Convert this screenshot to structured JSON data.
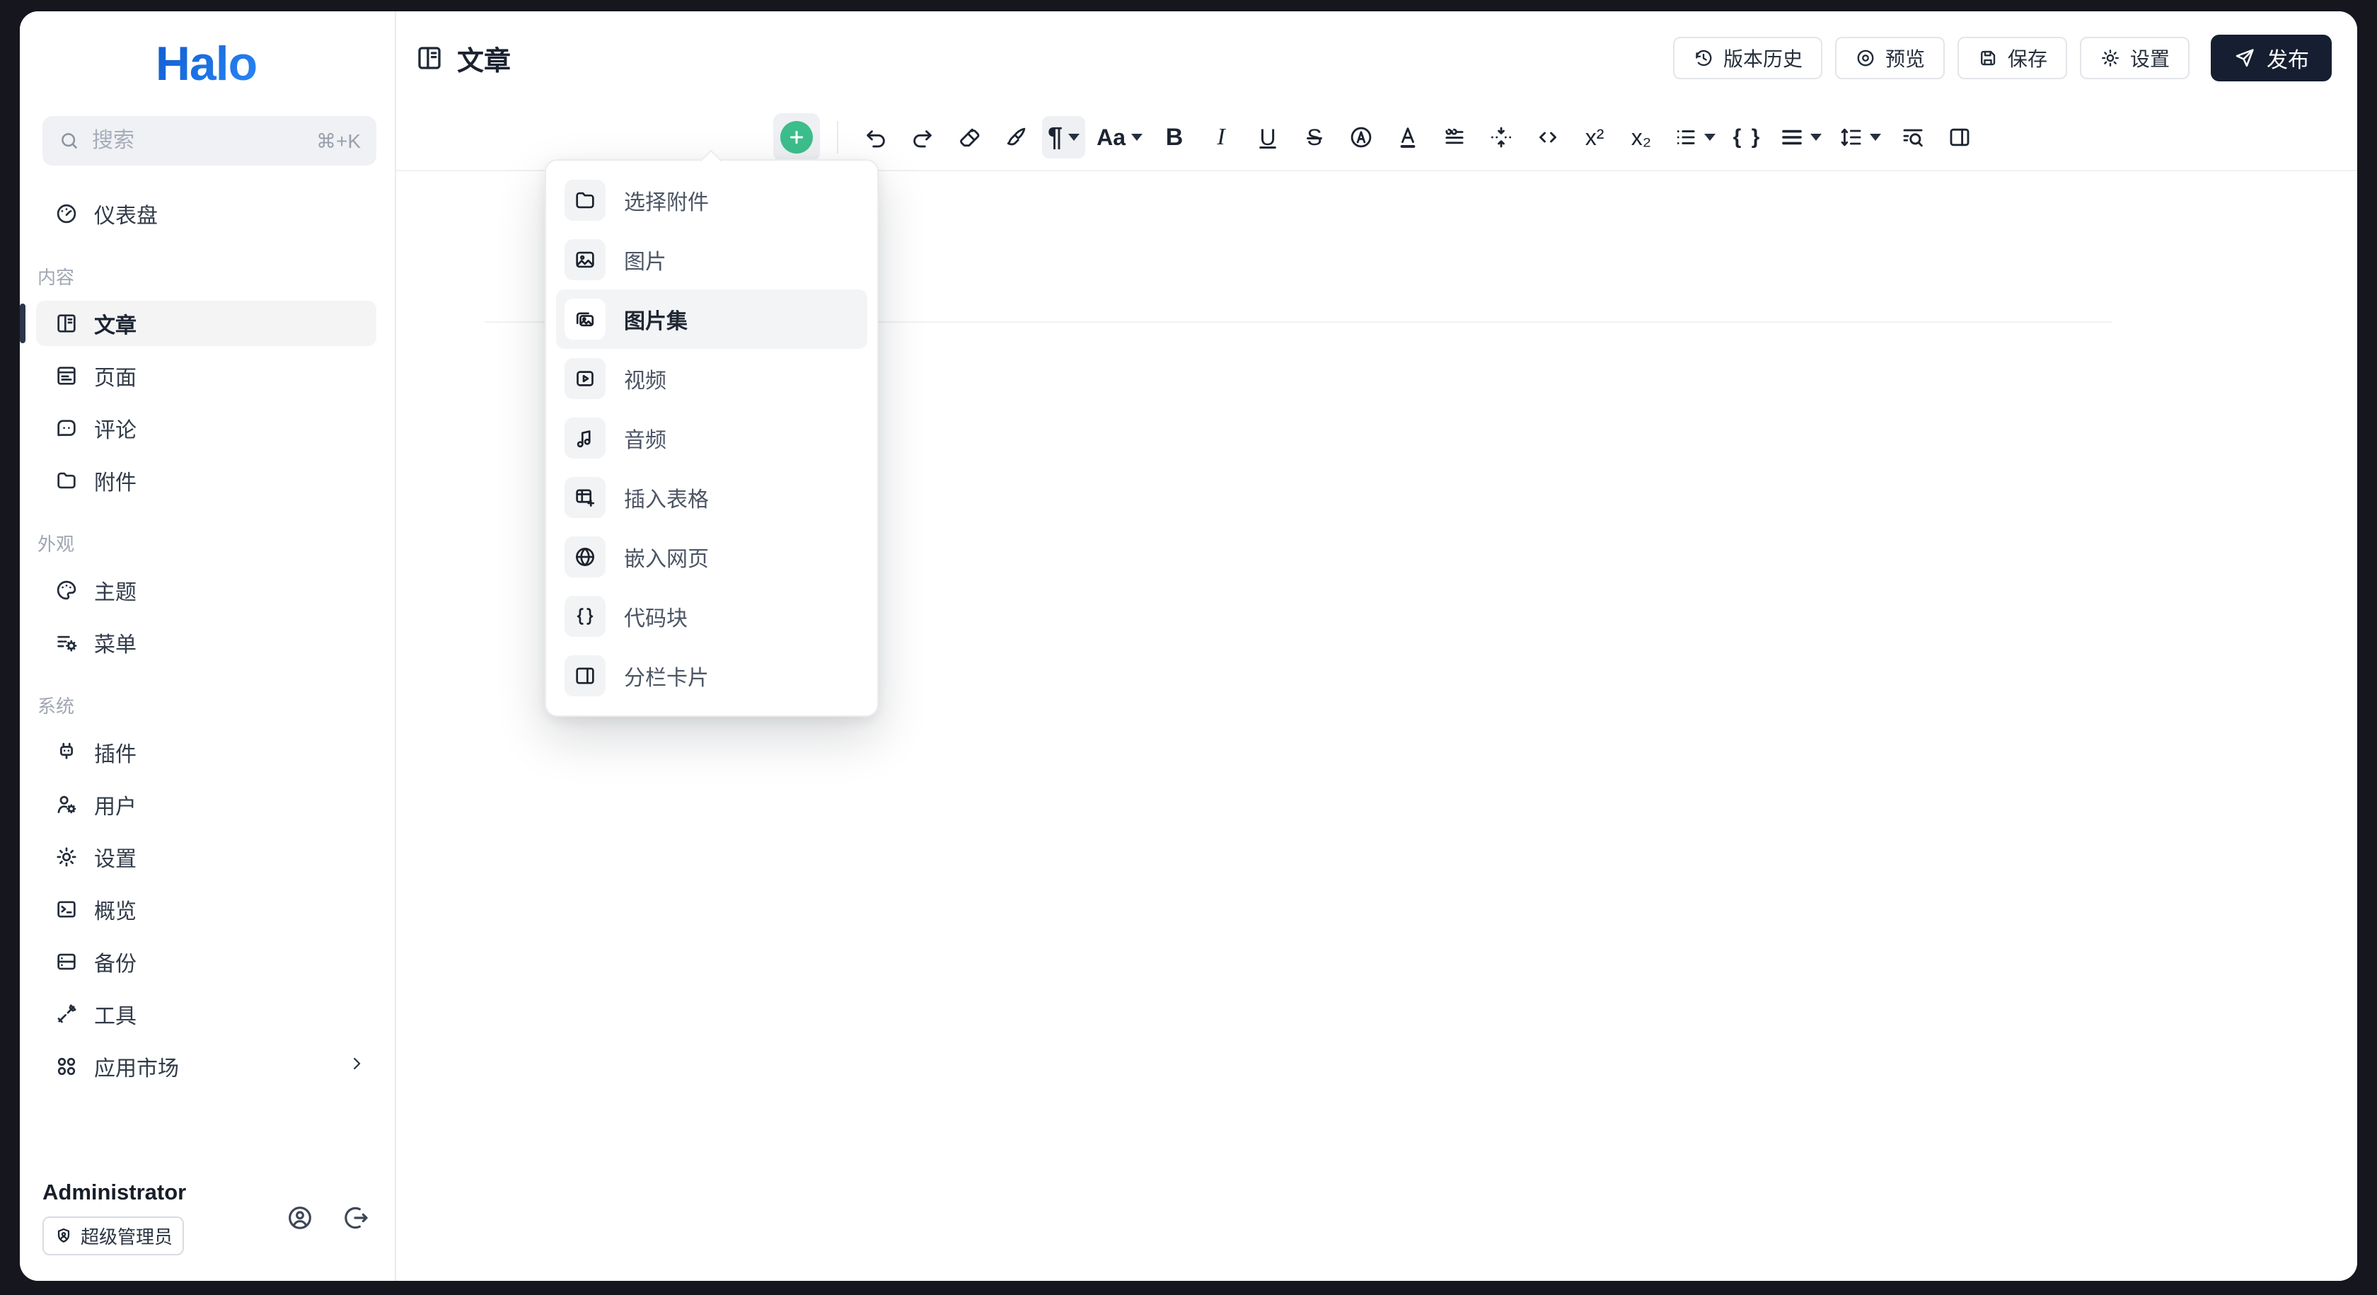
{
  "app": {
    "logo_text": "Halo"
  },
  "sidebar": {
    "search": {
      "placeholder": "搜索",
      "shortcut": "⌘+K"
    },
    "dashboard_label": "仪表盘",
    "sections": [
      {
        "label": "内容",
        "items": [
          {
            "label": "文章",
            "active": true
          },
          {
            "label": "页面"
          },
          {
            "label": "评论"
          },
          {
            "label": "附件"
          }
        ]
      },
      {
        "label": "外观",
        "items": [
          {
            "label": "主题"
          },
          {
            "label": "菜单"
          }
        ]
      },
      {
        "label": "系统",
        "items": [
          {
            "label": "插件"
          },
          {
            "label": "用户"
          },
          {
            "label": "设置"
          },
          {
            "label": "概览"
          },
          {
            "label": "备份"
          },
          {
            "label": "工具"
          },
          {
            "label": "应用市场",
            "has_submenu": true
          }
        ]
      }
    ],
    "user": {
      "name": "Administrator",
      "role": "超级管理员"
    }
  },
  "header": {
    "title": "文章",
    "actions": [
      {
        "label": "版本历史",
        "icon": "history-icon"
      },
      {
        "label": "预览",
        "icon": "preview-icon"
      },
      {
        "label": "保存",
        "icon": "save-icon"
      },
      {
        "label": "设置",
        "icon": "gear-icon"
      }
    ],
    "publish": {
      "label": "发布",
      "icon": "send-icon"
    }
  },
  "toolbar": {
    "icons": [
      "insert-plus",
      "undo",
      "redo",
      "eraser",
      "format-paint",
      "paragraph",
      "typography",
      "bold",
      "italic",
      "underline",
      "strikethrough",
      "highlight",
      "text-color",
      "blockquote",
      "vertical-collapse",
      "code",
      "superscript",
      "subscript",
      "bullet-list",
      "code-block",
      "align",
      "line-height",
      "find-replace",
      "columns"
    ],
    "glyphs": {
      "paragraph": "¶",
      "typography": "Aa",
      "bold": "B",
      "italic": "I",
      "underline": "U",
      "strikethrough": "S",
      "superscript": "x²",
      "subscript": "x₂",
      "code_block": "{ }"
    }
  },
  "insert_menu": {
    "items": [
      {
        "label": "选择附件",
        "icon": "folder-icon"
      },
      {
        "label": "图片",
        "icon": "image-icon"
      },
      {
        "label": "图片集",
        "icon": "images-icon",
        "active": true
      },
      {
        "label": "视频",
        "icon": "video-icon"
      },
      {
        "label": "音频",
        "icon": "audio-icon"
      },
      {
        "label": "插入表格",
        "icon": "table-plus-icon"
      },
      {
        "label": "嵌入网页",
        "icon": "globe-icon"
      },
      {
        "label": "代码块",
        "icon": "braces-icon"
      },
      {
        "label": "分栏卡片",
        "icon": "columns-icon"
      }
    ]
  },
  "colors": {
    "brand_blue": "#1b74e4",
    "accent_green": "#3cbe8c",
    "publish_bg": "#161f31",
    "frame_bg": "#16161e"
  }
}
